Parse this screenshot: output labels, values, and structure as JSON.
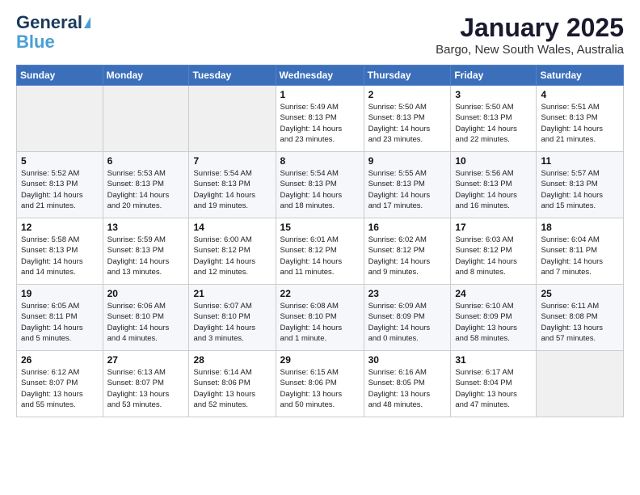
{
  "logo": {
    "line1": "General",
    "line2": "Blue"
  },
  "header": {
    "month": "January 2025",
    "location": "Bargo, New South Wales, Australia"
  },
  "weekdays": [
    "Sunday",
    "Monday",
    "Tuesday",
    "Wednesday",
    "Thursday",
    "Friday",
    "Saturday"
  ],
  "weeks": [
    [
      {
        "day": "",
        "info": ""
      },
      {
        "day": "",
        "info": ""
      },
      {
        "day": "",
        "info": ""
      },
      {
        "day": "1",
        "info": "Sunrise: 5:49 AM\nSunset: 8:13 PM\nDaylight: 14 hours\nand 23 minutes."
      },
      {
        "day": "2",
        "info": "Sunrise: 5:50 AM\nSunset: 8:13 PM\nDaylight: 14 hours\nand 23 minutes."
      },
      {
        "day": "3",
        "info": "Sunrise: 5:50 AM\nSunset: 8:13 PM\nDaylight: 14 hours\nand 22 minutes."
      },
      {
        "day": "4",
        "info": "Sunrise: 5:51 AM\nSunset: 8:13 PM\nDaylight: 14 hours\nand 21 minutes."
      }
    ],
    [
      {
        "day": "5",
        "info": "Sunrise: 5:52 AM\nSunset: 8:13 PM\nDaylight: 14 hours\nand 21 minutes."
      },
      {
        "day": "6",
        "info": "Sunrise: 5:53 AM\nSunset: 8:13 PM\nDaylight: 14 hours\nand 20 minutes."
      },
      {
        "day": "7",
        "info": "Sunrise: 5:54 AM\nSunset: 8:13 PM\nDaylight: 14 hours\nand 19 minutes."
      },
      {
        "day": "8",
        "info": "Sunrise: 5:54 AM\nSunset: 8:13 PM\nDaylight: 14 hours\nand 18 minutes."
      },
      {
        "day": "9",
        "info": "Sunrise: 5:55 AM\nSunset: 8:13 PM\nDaylight: 14 hours\nand 17 minutes."
      },
      {
        "day": "10",
        "info": "Sunrise: 5:56 AM\nSunset: 8:13 PM\nDaylight: 14 hours\nand 16 minutes."
      },
      {
        "day": "11",
        "info": "Sunrise: 5:57 AM\nSunset: 8:13 PM\nDaylight: 14 hours\nand 15 minutes."
      }
    ],
    [
      {
        "day": "12",
        "info": "Sunrise: 5:58 AM\nSunset: 8:13 PM\nDaylight: 14 hours\nand 14 minutes."
      },
      {
        "day": "13",
        "info": "Sunrise: 5:59 AM\nSunset: 8:13 PM\nDaylight: 14 hours\nand 13 minutes."
      },
      {
        "day": "14",
        "info": "Sunrise: 6:00 AM\nSunset: 8:12 PM\nDaylight: 14 hours\nand 12 minutes."
      },
      {
        "day": "15",
        "info": "Sunrise: 6:01 AM\nSunset: 8:12 PM\nDaylight: 14 hours\nand 11 minutes."
      },
      {
        "day": "16",
        "info": "Sunrise: 6:02 AM\nSunset: 8:12 PM\nDaylight: 14 hours\nand 9 minutes."
      },
      {
        "day": "17",
        "info": "Sunrise: 6:03 AM\nSunset: 8:12 PM\nDaylight: 14 hours\nand 8 minutes."
      },
      {
        "day": "18",
        "info": "Sunrise: 6:04 AM\nSunset: 8:11 PM\nDaylight: 14 hours\nand 7 minutes."
      }
    ],
    [
      {
        "day": "19",
        "info": "Sunrise: 6:05 AM\nSunset: 8:11 PM\nDaylight: 14 hours\nand 5 minutes."
      },
      {
        "day": "20",
        "info": "Sunrise: 6:06 AM\nSunset: 8:10 PM\nDaylight: 14 hours\nand 4 minutes."
      },
      {
        "day": "21",
        "info": "Sunrise: 6:07 AM\nSunset: 8:10 PM\nDaylight: 14 hours\nand 3 minutes."
      },
      {
        "day": "22",
        "info": "Sunrise: 6:08 AM\nSunset: 8:10 PM\nDaylight: 14 hours\nand 1 minute."
      },
      {
        "day": "23",
        "info": "Sunrise: 6:09 AM\nSunset: 8:09 PM\nDaylight: 14 hours\nand 0 minutes."
      },
      {
        "day": "24",
        "info": "Sunrise: 6:10 AM\nSunset: 8:09 PM\nDaylight: 13 hours\nand 58 minutes."
      },
      {
        "day": "25",
        "info": "Sunrise: 6:11 AM\nSunset: 8:08 PM\nDaylight: 13 hours\nand 57 minutes."
      }
    ],
    [
      {
        "day": "26",
        "info": "Sunrise: 6:12 AM\nSunset: 8:07 PM\nDaylight: 13 hours\nand 55 minutes."
      },
      {
        "day": "27",
        "info": "Sunrise: 6:13 AM\nSunset: 8:07 PM\nDaylight: 13 hours\nand 53 minutes."
      },
      {
        "day": "28",
        "info": "Sunrise: 6:14 AM\nSunset: 8:06 PM\nDaylight: 13 hours\nand 52 minutes."
      },
      {
        "day": "29",
        "info": "Sunrise: 6:15 AM\nSunset: 8:06 PM\nDaylight: 13 hours\nand 50 minutes."
      },
      {
        "day": "30",
        "info": "Sunrise: 6:16 AM\nSunset: 8:05 PM\nDaylight: 13 hours\nand 48 minutes."
      },
      {
        "day": "31",
        "info": "Sunrise: 6:17 AM\nSunset: 8:04 PM\nDaylight: 13 hours\nand 47 minutes."
      },
      {
        "day": "",
        "info": ""
      }
    ]
  ]
}
